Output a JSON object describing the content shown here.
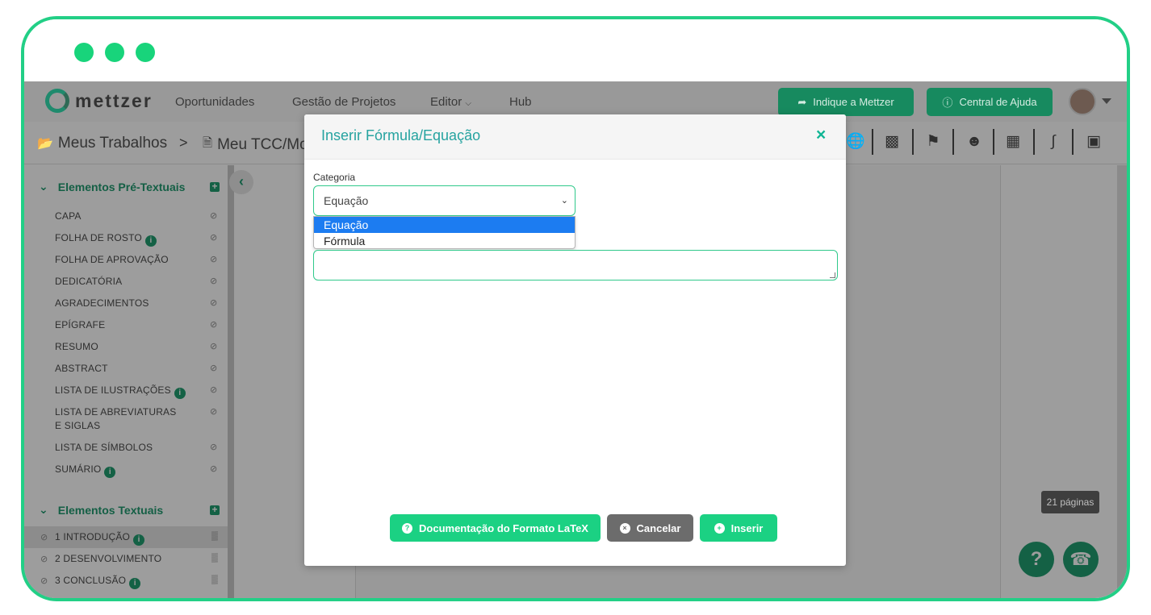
{
  "window": {
    "traffic_dots": [
      "dot-1",
      "dot-2",
      "dot-3"
    ],
    "accent_color": "#22cf86"
  },
  "topnav": {
    "logo_text": "mettzer",
    "links": [
      "Oportunidades",
      "Gestão de Projetos",
      "Editor",
      "Hub"
    ],
    "indique_label": "Indique a Mettzer",
    "help_label": "Central de Ajuda"
  },
  "breadcrumb": {
    "root": "Meus Trabalhos",
    "separator": ">",
    "current": "Meu TCC/Mo"
  },
  "toolbar": {
    "icons": [
      "globe-icon",
      "book-icon",
      "flag-icon",
      "users-icon",
      "calendar-icon",
      "thermometer-icon",
      "save-icon"
    ]
  },
  "sidebar": {
    "pre_textual": {
      "title": "Elementos Pré-Textuais",
      "items": [
        {
          "label": "CAPA",
          "info": false
        },
        {
          "label": "FOLHA DE ROSTO",
          "info": true
        },
        {
          "label": "FOLHA DE APROVAÇÃO",
          "info": false
        },
        {
          "label": "DEDICATÓRIA",
          "info": false
        },
        {
          "label": "AGRADECIMENTOS",
          "info": false
        },
        {
          "label": "EPÍGRAFE",
          "info": false
        },
        {
          "label": "RESUMO",
          "info": false
        },
        {
          "label": "ABSTRACT",
          "info": false
        },
        {
          "label": "LISTA DE ILUSTRAÇÕES",
          "info": true
        },
        {
          "label": "LISTA DE ABREVIATURAS E SIGLAS",
          "info": false
        },
        {
          "label": "LISTA DE SÍMBOLOS",
          "info": false
        },
        {
          "label": "SUMÁRIO",
          "info": true
        }
      ]
    },
    "textual": {
      "title": "Elementos Textuais",
      "items": [
        {
          "label": "1 INTRODUÇÃO",
          "info": true,
          "active": true
        },
        {
          "label": "2 DESENVOLVIMENTO",
          "info": false,
          "active": false
        },
        {
          "label": "3 CONCLUSÃO",
          "info": true,
          "active": false
        }
      ]
    }
  },
  "editor": {
    "pages_badge": "21 páginas"
  },
  "modal": {
    "title": "Inserir Fórmula/Equação",
    "close": "×",
    "category_label": "Categoria",
    "category_value": "Equação",
    "category_options": [
      "Equação",
      "Fórmula"
    ],
    "selected_index": 0,
    "buttons": {
      "doc": "Documentação do Formato LaTeX",
      "cancel": "Cancelar",
      "insert": "Inserir"
    }
  }
}
